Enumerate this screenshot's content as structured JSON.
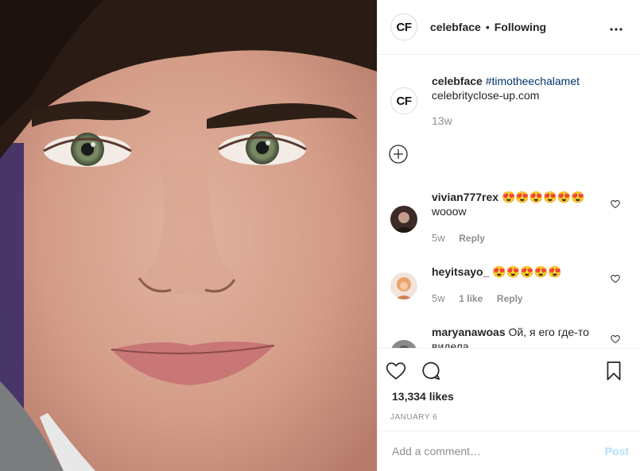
{
  "post_image": {
    "alt_subject": "close-up portrait photo"
  },
  "header": {
    "avatar_text": "CF",
    "username": "celebface",
    "separator": "•",
    "follow_status": "Following",
    "more_icon": "more-horizontal-icon"
  },
  "caption": {
    "avatar_text": "CF",
    "username": "celebface",
    "hashtag": "#timotheechalamet",
    "text": "celebrityclose-up.com",
    "time": "13w"
  },
  "load_more_icon": "plus-circle-icon",
  "comments": [
    {
      "username": "vivian777rex",
      "emoji": "😍😍😍😍😍😍",
      "text": "wooow",
      "time": "5w",
      "likes": "",
      "reply_label": "Reply"
    },
    {
      "username": "heyitsayo_",
      "emoji": "😍😍😍😍😍",
      "text": "",
      "time": "5w",
      "likes": "1 like",
      "reply_label": "Reply"
    },
    {
      "username": "maryanawoas",
      "emoji": "",
      "text": "Ой, я его где-то видела",
      "time": "",
      "likes": "",
      "reply_label": ""
    }
  ],
  "actions": {
    "like_icon": "heart-icon",
    "comment_icon": "comment-icon",
    "save_icon": "bookmark-icon",
    "likes_count": "13,334 likes",
    "date": "JANUARY 6"
  },
  "add_comment": {
    "placeholder": "Add a comment…",
    "post_label": "Post"
  },
  "colors": {
    "hashtag": "#003569",
    "post_disabled": "#b2dffc",
    "muted": "#8e8e8e",
    "border": "#efefef"
  }
}
